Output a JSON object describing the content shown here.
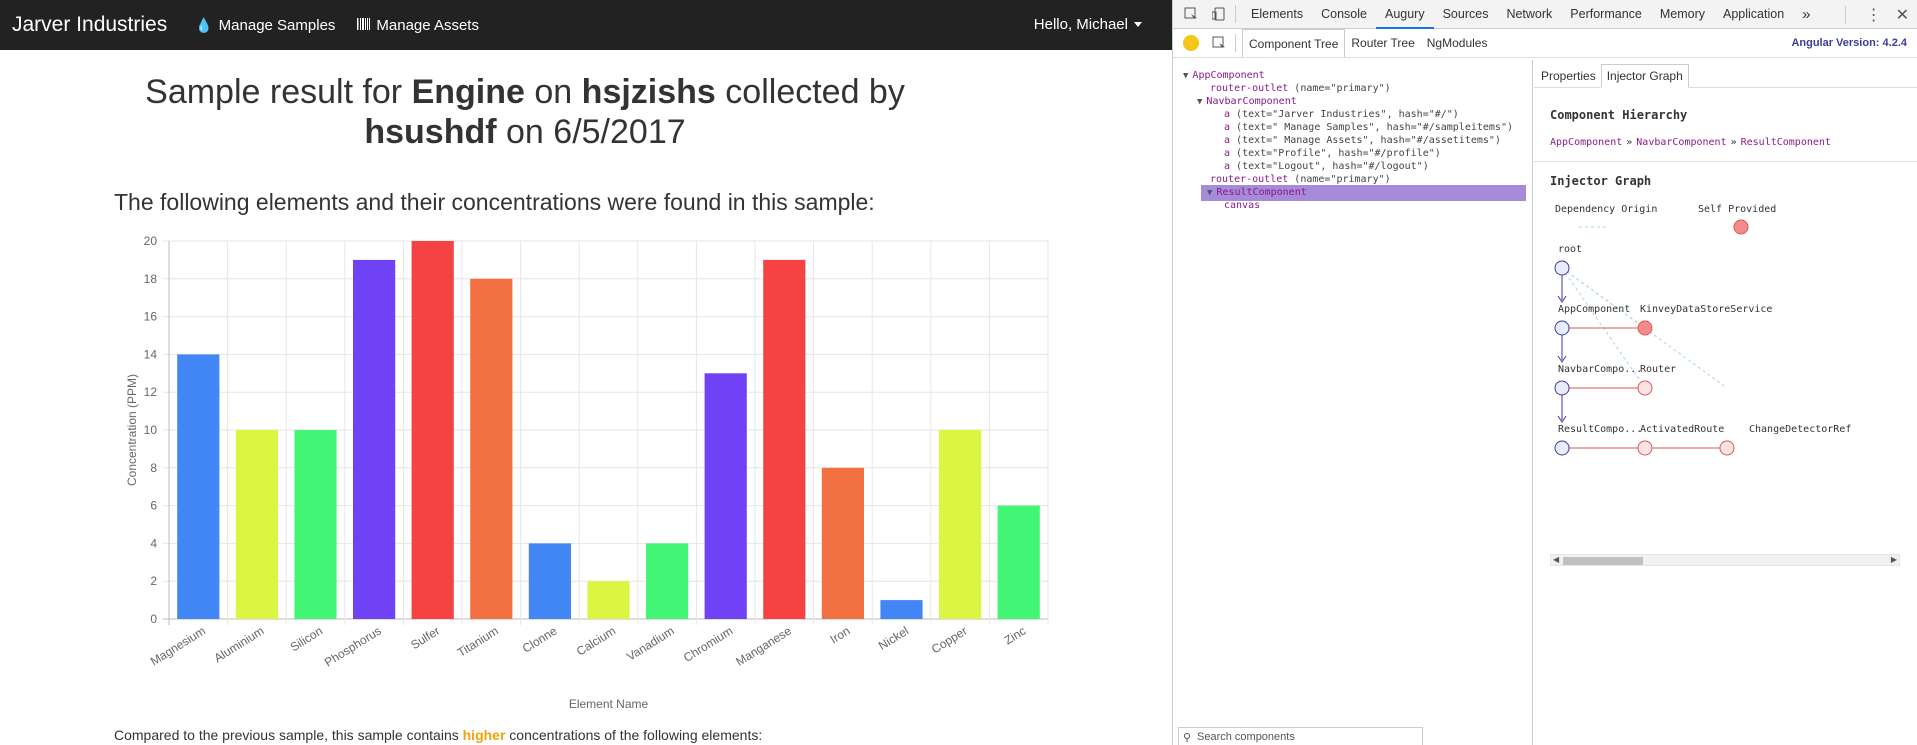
{
  "navbar": {
    "brand": "Jarver Industries",
    "links": [
      {
        "label": "Manage Samples",
        "icon": "tint-icon"
      },
      {
        "label": "Manage Assets",
        "icon": "barcode-icon"
      }
    ],
    "user": "Hello, Michael"
  },
  "headline": {
    "prefix": "Sample result for",
    "type": "Engine",
    "on1": "on",
    "asset": "hsjzishs",
    "collected": "collected by",
    "collector": "hsushdf",
    "on2": "on",
    "date": "6/5/2017"
  },
  "subheading": "The following elements and their concentrations were found in this sample:",
  "compare": {
    "prefix": "Compared to the previous sample, this sample contains",
    "highlight": "higher",
    "suffix": "concentrations of the following elements:"
  },
  "chart_data": {
    "type": "bar",
    "categories": [
      "Magnesium",
      "Aluminium",
      "Silicon",
      "Phosphorus",
      "Sulfer",
      "Titanium",
      "Clonne",
      "Calcium",
      "Vanadium",
      "Chromium",
      "Manganese",
      "Iron",
      "Nickel",
      "Copper",
      "Zinc"
    ],
    "values": [
      14,
      10,
      10,
      19,
      20,
      18,
      4,
      2,
      4,
      13,
      19,
      8,
      1,
      10,
      6
    ],
    "colors": [
      "#4287f5",
      "#dcf542",
      "#42f575",
      "#6f42f5",
      "#f54242",
      "#f27042",
      "#4287f5",
      "#dcf542",
      "#42f575",
      "#6f42f5",
      "#f54242",
      "#f27042",
      "#4287f5",
      "#dcf542",
      "#42f575"
    ],
    "ylabel": "Concentration (PPM)",
    "xlabel": "Element Name",
    "ylim": [
      0,
      20
    ],
    "yticks": [
      0,
      2,
      4,
      6,
      8,
      10,
      12,
      14,
      16,
      18,
      20
    ],
    "grid": true
  },
  "devtools": {
    "tabs": [
      "Elements",
      "Console",
      "Augury",
      "Sources",
      "Network",
      "Performance",
      "Memory",
      "Application"
    ],
    "active_tab": "Augury",
    "more": "»",
    "augury_tabs": [
      "Component Tree",
      "Router Tree",
      "NgModules"
    ],
    "angular_version_label": "Angular Version:",
    "angular_version": "4.2.4",
    "tree": [
      {
        "indent": 0,
        "toggle": "▼",
        "tag": "AppComponent",
        "attr": ""
      },
      {
        "indent": 1,
        "toggle": "",
        "tag": "router-outlet",
        "attr": " (name=\"primary\")"
      },
      {
        "indent": 1,
        "toggle": "▼",
        "tag": "NavbarComponent",
        "attr": ""
      },
      {
        "indent": 2,
        "toggle": "",
        "tag": "a",
        "attr": " (text=\"Jarver Industries\", hash=\"#/\")"
      },
      {
        "indent": 2,
        "toggle": "",
        "tag": "a",
        "attr": " (text=\" Manage Samples\", hash=\"#/sampleitems\")"
      },
      {
        "indent": 2,
        "toggle": "",
        "tag": "a",
        "attr": " (text=\" Manage Assets\", hash=\"#/assetitems\")"
      },
      {
        "indent": 2,
        "toggle": "",
        "tag": "a",
        "attr": " (text=\"Profile\", hash=\"#/profile\")"
      },
      {
        "indent": 2,
        "toggle": "",
        "tag": "a",
        "attr": " (text=\"Logout\", hash=\"#/logout\")"
      },
      {
        "indent": 1,
        "toggle": "",
        "tag": "router-outlet",
        "attr": " (name=\"primary\")"
      },
      {
        "indent": 1,
        "toggle": "▼",
        "tag": "ResultComponent",
        "attr": "",
        "selected": true
      },
      {
        "indent": 2,
        "toggle": "",
        "tag": "canvas",
        "attr": ""
      }
    ],
    "search_placeholder": "Search components",
    "side_tabs": [
      "Properties",
      "Injector Graph"
    ],
    "active_side_tab": "Injector Graph",
    "hierarchy_title": "Component Hierarchy",
    "hierarchy": [
      "AppComponent",
      "NavbarComponent",
      "ResultComponent"
    ],
    "hierarchy_sep": "»",
    "injector_title": "Injector Graph",
    "legend": {
      "origin": "Dependency Origin",
      "self": "Self Provided"
    },
    "graph_labels": {
      "root": "root",
      "app": "AppComponent",
      "kinvey": "KinveyDataStoreService",
      "navbar": "NavbarCompo...",
      "router": "Router",
      "result": "ResultCompo...",
      "activated": "ActivatedRoute",
      "cdr": "ChangeDetectorRef"
    }
  }
}
